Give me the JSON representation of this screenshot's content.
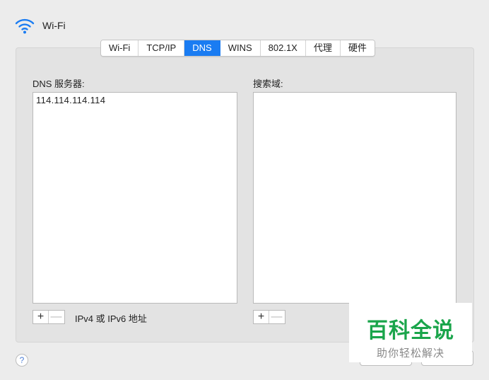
{
  "header": {
    "title": "Wi-Fi",
    "icon": "wifi-icon"
  },
  "tabs": [
    {
      "label": "Wi-Fi",
      "active": false
    },
    {
      "label": "TCP/IP",
      "active": false
    },
    {
      "label": "DNS",
      "active": true
    },
    {
      "label": "WINS",
      "active": false
    },
    {
      "label": "802.1X",
      "active": false
    },
    {
      "label": "代理",
      "active": false
    },
    {
      "label": "硬件",
      "active": false
    }
  ],
  "dns": {
    "label": "DNS 服务器:",
    "servers": [
      "114.114.114.114"
    ],
    "add_label": "+",
    "remove_label": "—",
    "hint": "IPv4 或 IPv6 地址"
  },
  "search": {
    "label": "搜索域:",
    "domains": [],
    "add_label": "+",
    "remove_label": "—"
  },
  "help": {
    "label": "?"
  },
  "watermark": {
    "main": "百科全说",
    "sub": "助你轻松解决"
  },
  "colors": {
    "accent": "#1a7cf2",
    "watermark": "#1aa54b"
  }
}
